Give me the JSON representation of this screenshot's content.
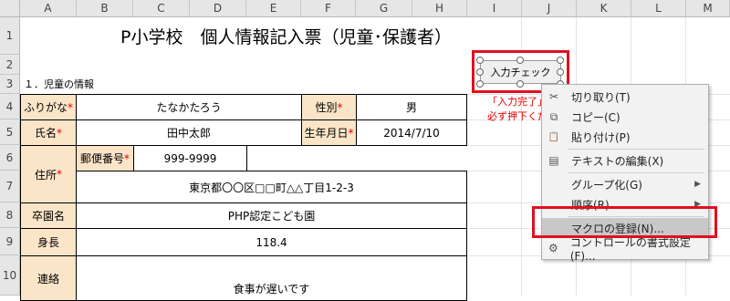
{
  "columns": [
    "A",
    "B",
    "C",
    "D",
    "E",
    "F",
    "G",
    "H",
    "I",
    "J",
    "K",
    "L",
    "M"
  ],
  "rows": [
    "1",
    "2",
    "3",
    "4",
    "5",
    "6",
    "7",
    "8",
    "9",
    "10"
  ],
  "title": "P小学校　個人情報記入票（児童･保護者）",
  "section_heading": "１．児童の情報",
  "form": {
    "furigana_label": "ふりがな",
    "furigana_value": "たなかたろう",
    "name_label": "氏名",
    "name_value": "田中太郎",
    "gender_label": "性別",
    "gender_value": "男",
    "birth_label": "生年月日",
    "birth_value": "2014/7/10",
    "address_label": "住所",
    "postal_label": "郵便番号",
    "postal_value": "999-9999",
    "address_value": "東京都〇〇区□□町△△丁目1-2-3",
    "kindergarten_label": "卒園名",
    "kindergarten_value": "PHP認定こども園",
    "height_label": "身長",
    "height_value": "118.4",
    "contact_label": "連絡",
    "contact_value": "食事が遅いです",
    "required_mark": "*"
  },
  "input_check_button": "入力チェック",
  "note_line1": "「入力完了」",
  "note_line2": "必ず押下くださ",
  "context_menu": {
    "items": [
      {
        "icon": "scissors-icon",
        "glyph": "✂",
        "label": "切り取り(T)",
        "submenu": false
      },
      {
        "icon": "copy-icon",
        "glyph": "⧉",
        "label": "コピー(C)",
        "submenu": false
      },
      {
        "icon": "paste-icon",
        "glyph": "📋",
        "label": "貼り付け(P)",
        "submenu": false
      },
      {
        "icon": "edit-text-icon",
        "glyph": "▤",
        "label": "テキストの編集(X)",
        "submenu": false
      },
      {
        "icon": "",
        "glyph": "",
        "label": "グループ化(G)",
        "submenu": true
      },
      {
        "icon": "",
        "glyph": "",
        "label": "順序(R)",
        "submenu": true
      },
      {
        "icon": "",
        "glyph": "",
        "label": "マクロの登録(N)...",
        "submenu": false,
        "highlighted": true
      },
      {
        "icon": "format-control-icon",
        "glyph": "⚙",
        "label": "コントロールの書式設定(F)...",
        "submenu": false
      }
    ]
  },
  "colors": {
    "accent_red": "#e01020",
    "label_fill": "#fbe5c8",
    "required": "#e00000"
  }
}
